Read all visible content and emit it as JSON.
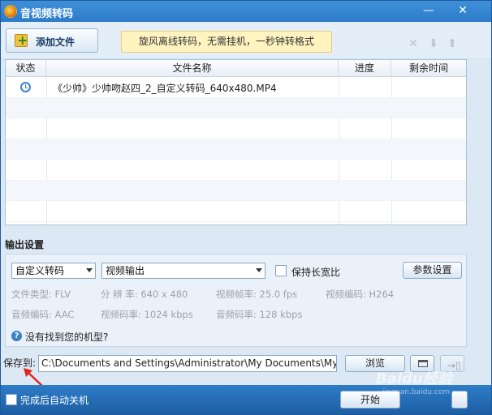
{
  "window": {
    "title": "音视频转码",
    "minimize": "—",
    "close": "✕"
  },
  "toolbar": {
    "add_file_label": "添加文件",
    "promo_text": "旋风离线转码，无需挂机，一秒钟转格式",
    "icons": [
      "delete-icon",
      "move-down-icon",
      "move-up-icon"
    ]
  },
  "table": {
    "headers": {
      "status": "状态",
      "name": "文件名称",
      "progress": "进度",
      "remaining": "剩余时间"
    },
    "rows": [
      {
        "status_icon": "clock-icon",
        "name": "《少帅》少帅吻赵四_2_自定义转码_640x480.MP4",
        "progress": "",
        "remaining": ""
      }
    ]
  },
  "output": {
    "section_title": "输出设置",
    "profile_select": "自定义转码",
    "output_select": "视频输出",
    "keep_ratio_label": "保持长宽比",
    "keep_ratio_checked": false,
    "param_button": "参数设置",
    "info": {
      "file_type": "文件类型:  FLV",
      "resolution": "分 辨 率:   640 x 480",
      "frame_rate": "视频帧率:   25.0 fps",
      "video_codec": "视频编码:   H264",
      "audio_codec": "音频编码:   AAC",
      "video_bitrate": "视频码率:   1024 kbps",
      "audio_bitrate": "音频码率:   128 kbps"
    },
    "help_text": "没有找到您的机型?"
  },
  "save": {
    "label": "保存到:",
    "path": "C:\\Documents and Settings\\Administrator\\My Documents\\My Vide",
    "browse_button": "浏览"
  },
  "bottom": {
    "shutdown_label": "完成后自动关机",
    "shutdown_checked": false,
    "start_button": "开始"
  },
  "watermark": {
    "text": "Baidu经验",
    "sub": "jingyan.baidu.com"
  },
  "colors": {
    "titlebar": "#2b79c8",
    "annotation_arrow": "#e0251b"
  }
}
